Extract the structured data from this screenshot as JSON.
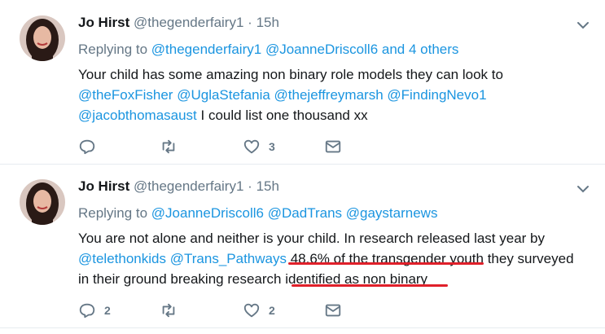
{
  "tweets": [
    {
      "name": "Jo Hirst",
      "handle": "@thegenderfairy1",
      "dot": "·",
      "time": "15h",
      "reply_prefix": "Replying to",
      "reply_links": [
        "@thegenderfairy1",
        "@JoanneDriscoll6"
      ],
      "reply_suffix": "and 4 others",
      "body": {
        "line1": "Your child has some amazing non binary role models they can look to",
        "line2_links": [
          "@theFoxFisher",
          "@UglaStefania",
          "@thejeffreymarsh",
          "@FindingNevo1"
        ],
        "line3_link": "@jacobthomasaust",
        "line3_text": "I could list one thousand xx"
      },
      "actions": {
        "reply_count": "",
        "retweet_count": "",
        "like_count": "3"
      }
    },
    {
      "name": "Jo Hirst",
      "handle": "@thegenderfairy1",
      "dot": "·",
      "time": "15h",
      "reply_prefix": "Replying to",
      "reply_links": [
        "@JoanneDriscoll6",
        "@DadTrans",
        "@gaystarnews"
      ],
      "body": {
        "line1": "You are not alone and neither is your child. In research released last year by",
        "line2_links": [
          "@telethonkids",
          "@Trans_Pathways"
        ],
        "line2_highlight": "48.6% of the transgender youth",
        "line2_text": "they surveyed",
        "line3_text": "in their ground breaking research",
        "line3_highlight": "identified as non binary"
      },
      "actions": {
        "reply_count": "2",
        "retweet_count": "",
        "like_count": "2"
      }
    }
  ],
  "colors": {
    "link": "#1b95e0",
    "muted": "#657786",
    "underline": "#e0202a"
  },
  "icons": [
    "reply-icon",
    "retweet-icon",
    "like-icon",
    "message-icon",
    "chevron-down-icon"
  ]
}
